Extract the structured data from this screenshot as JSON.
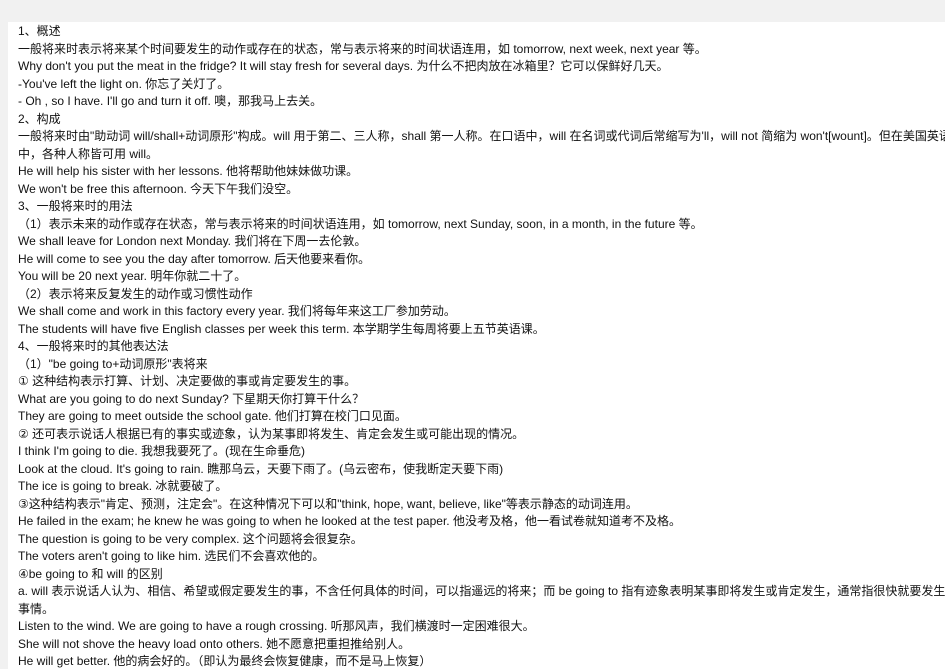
{
  "document": {
    "lines": [
      "1、概述",
      "一般将来时表示将来某个时间要发生的动作或存在的状态，常与表示将来的时间状语连用，如 tomorrow, next week, next year 等。",
      "Why don't you put the meat in the fridge? It will stay fresh for several days. 为什么不把肉放在冰箱里？它可以保鲜好几天。",
      "-You've left the light on.  你忘了关灯了。",
      "- Oh , so I have. I'll go and turn it off.  噢，那我马上去关。",
      "2、构成",
      "一般将来时由\"助动词 will/shall+动词原形\"构成。will 用于第二、三人称，shall 第一人称。在口语中，will 在名词或代词后常缩写为'll，will not 简缩为 won't[wount]。但在美国英语",
      "中，各种人称皆可用 will。",
      "He will help his sister with her lessons. 他将帮助他妹妹做功课。",
      "We won't be free this afternoon. 今天下午我们没空。",
      "3、一般将来时的用法",
      "（1）表示未来的动作或存在状态，常与表示将来的时间状语连用，如 tomorrow, next Sunday, soon, in a month, in the future 等。",
      "We shall leave for London next Monday. 我们将在下周一去伦敦。",
      "He will come to see you the day after tomorrow. 后天他要来看你。",
      "You will be 20 next year. 明年你就二十了。",
      "（2）表示将来反复发生的动作或习惯性动作",
      "We shall come and work in this factory every year. 我们将每年来这工厂参加劳动。",
      "The students will have five English classes per week this term. 本学期学生每周将要上五节英语课。",
      "4、一般将来时的其他表达法",
      "（1）\"be going to+动词原形\"表将来",
      "① 这种结构表示打算、计划、决定要做的事或肯定要发生的事。",
      "What are you going to do next Sunday?  下星期天你打算干什么？",
      "They are going to meet outside the school gate. 他们打算在校门口见面。",
      "② 还可表示说话人根据已有的事实或迹象，认为某事即将发生、肯定会发生或可能出现的情况。",
      "I think I'm going to die.  我想我要死了。(现在生命垂危)",
      "Look at the cloud. It's going to rain. 瞧那乌云，天要下雨了。(乌云密布，使我断定天要下雨)",
      "The ice is going to break. 冰就要破了。",
      "③这种结构表示\"肯定、预测，注定会\"。在这种情况下可以和\"think, hope, want, believe, like\"等表示静态的动词连用。",
      "He failed in the exam; he knew he was going to when he looked at the test paper. 他没考及格，他一看试卷就知道考不及格。",
      "The question is going to be very complex. 这个问题将会很复杂。",
      "The voters aren't going to like him. 选民们不会喜欢他的。",
      "④be going to  和 will 的区别",
      "a. will 表示说话人认为、相信、希望或假定要发生的事，不含任何具体的时间，可以指遥远的将来；而  be going to  指有迹象表明某事即将发生或肯定发生，通常指很快就要发生的",
      "事情。",
      "Listen to the wind. We are going to have a rough crossing. 听那风声，我们横渡时一定困难很大。",
      "She will not shove the heavy load onto others. 她不愿意把重担推给别人。",
      "He will get better. 他的病会好的。（即认为最终会恢复健康，而不是马上恢复）"
    ]
  }
}
